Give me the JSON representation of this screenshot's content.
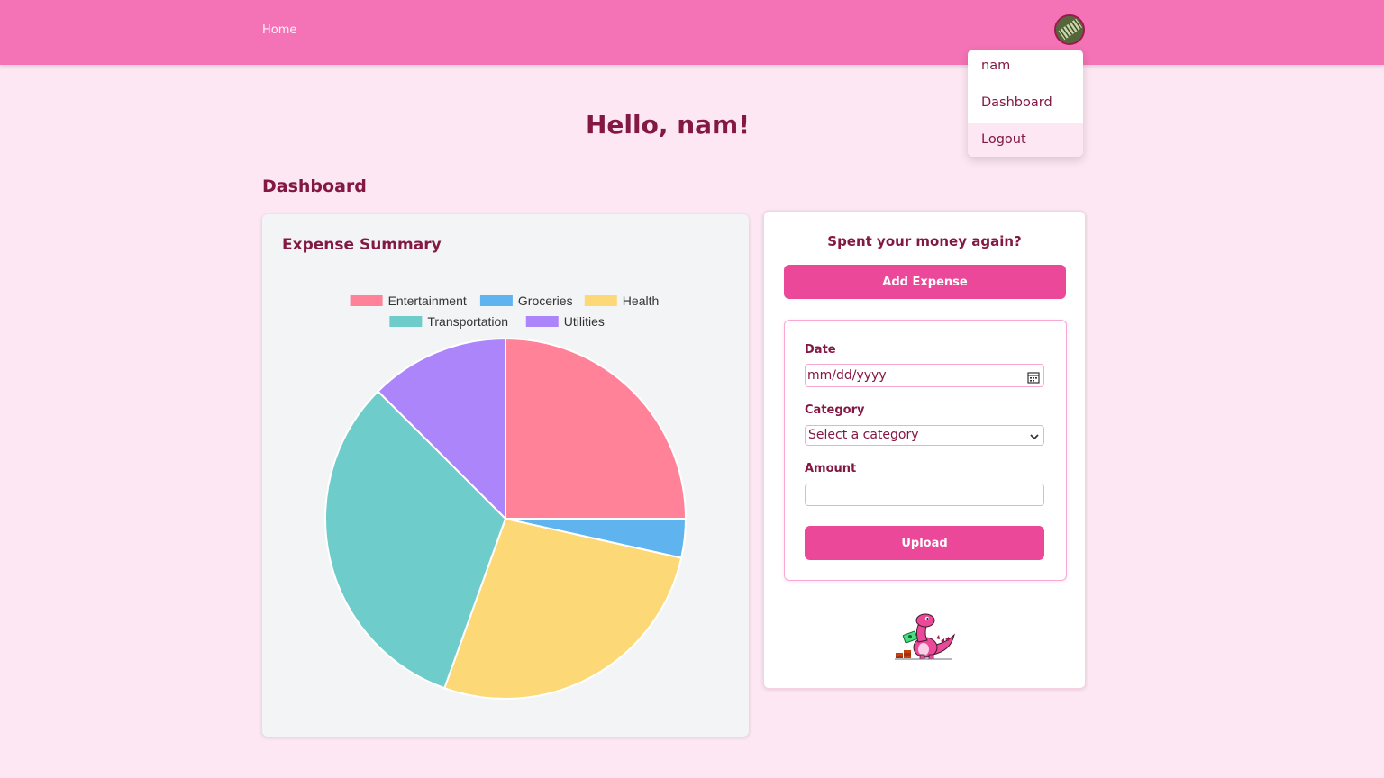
{
  "nav": {
    "home_label": "Home"
  },
  "user_menu": {
    "items": [
      "nam",
      "Dashboard",
      "Logout"
    ]
  },
  "greeting": "Hello, nam!",
  "section_title": "Dashboard",
  "summary": {
    "title": "Expense Summary"
  },
  "chart_data": {
    "type": "pie",
    "title": "",
    "categories": [
      "Entertainment",
      "Groceries",
      "Health",
      "Transportation",
      "Utilities"
    ],
    "values": [
      25,
      3.5,
      27,
      32,
      12.5
    ],
    "colors": [
      "#ff8299",
      "#5fb3ef",
      "#fdd876",
      "#6ecdcb",
      "#ad85fb"
    ],
    "legend_position": "top"
  },
  "form": {
    "heading": "Spent your money again?",
    "add_button": "Add Expense",
    "date_label": "Date",
    "date_placeholder": "mm/dd/yyyy",
    "category_label": "Category",
    "category_selected": "Select a category",
    "amount_label": "Amount",
    "amount_value": "",
    "upload_button": "Upload"
  },
  "icons": {
    "avatar": "user-avatar",
    "date": "calendar-icon",
    "select": "chevron-down-icon",
    "mascot": "dinosaur-mascot"
  }
}
